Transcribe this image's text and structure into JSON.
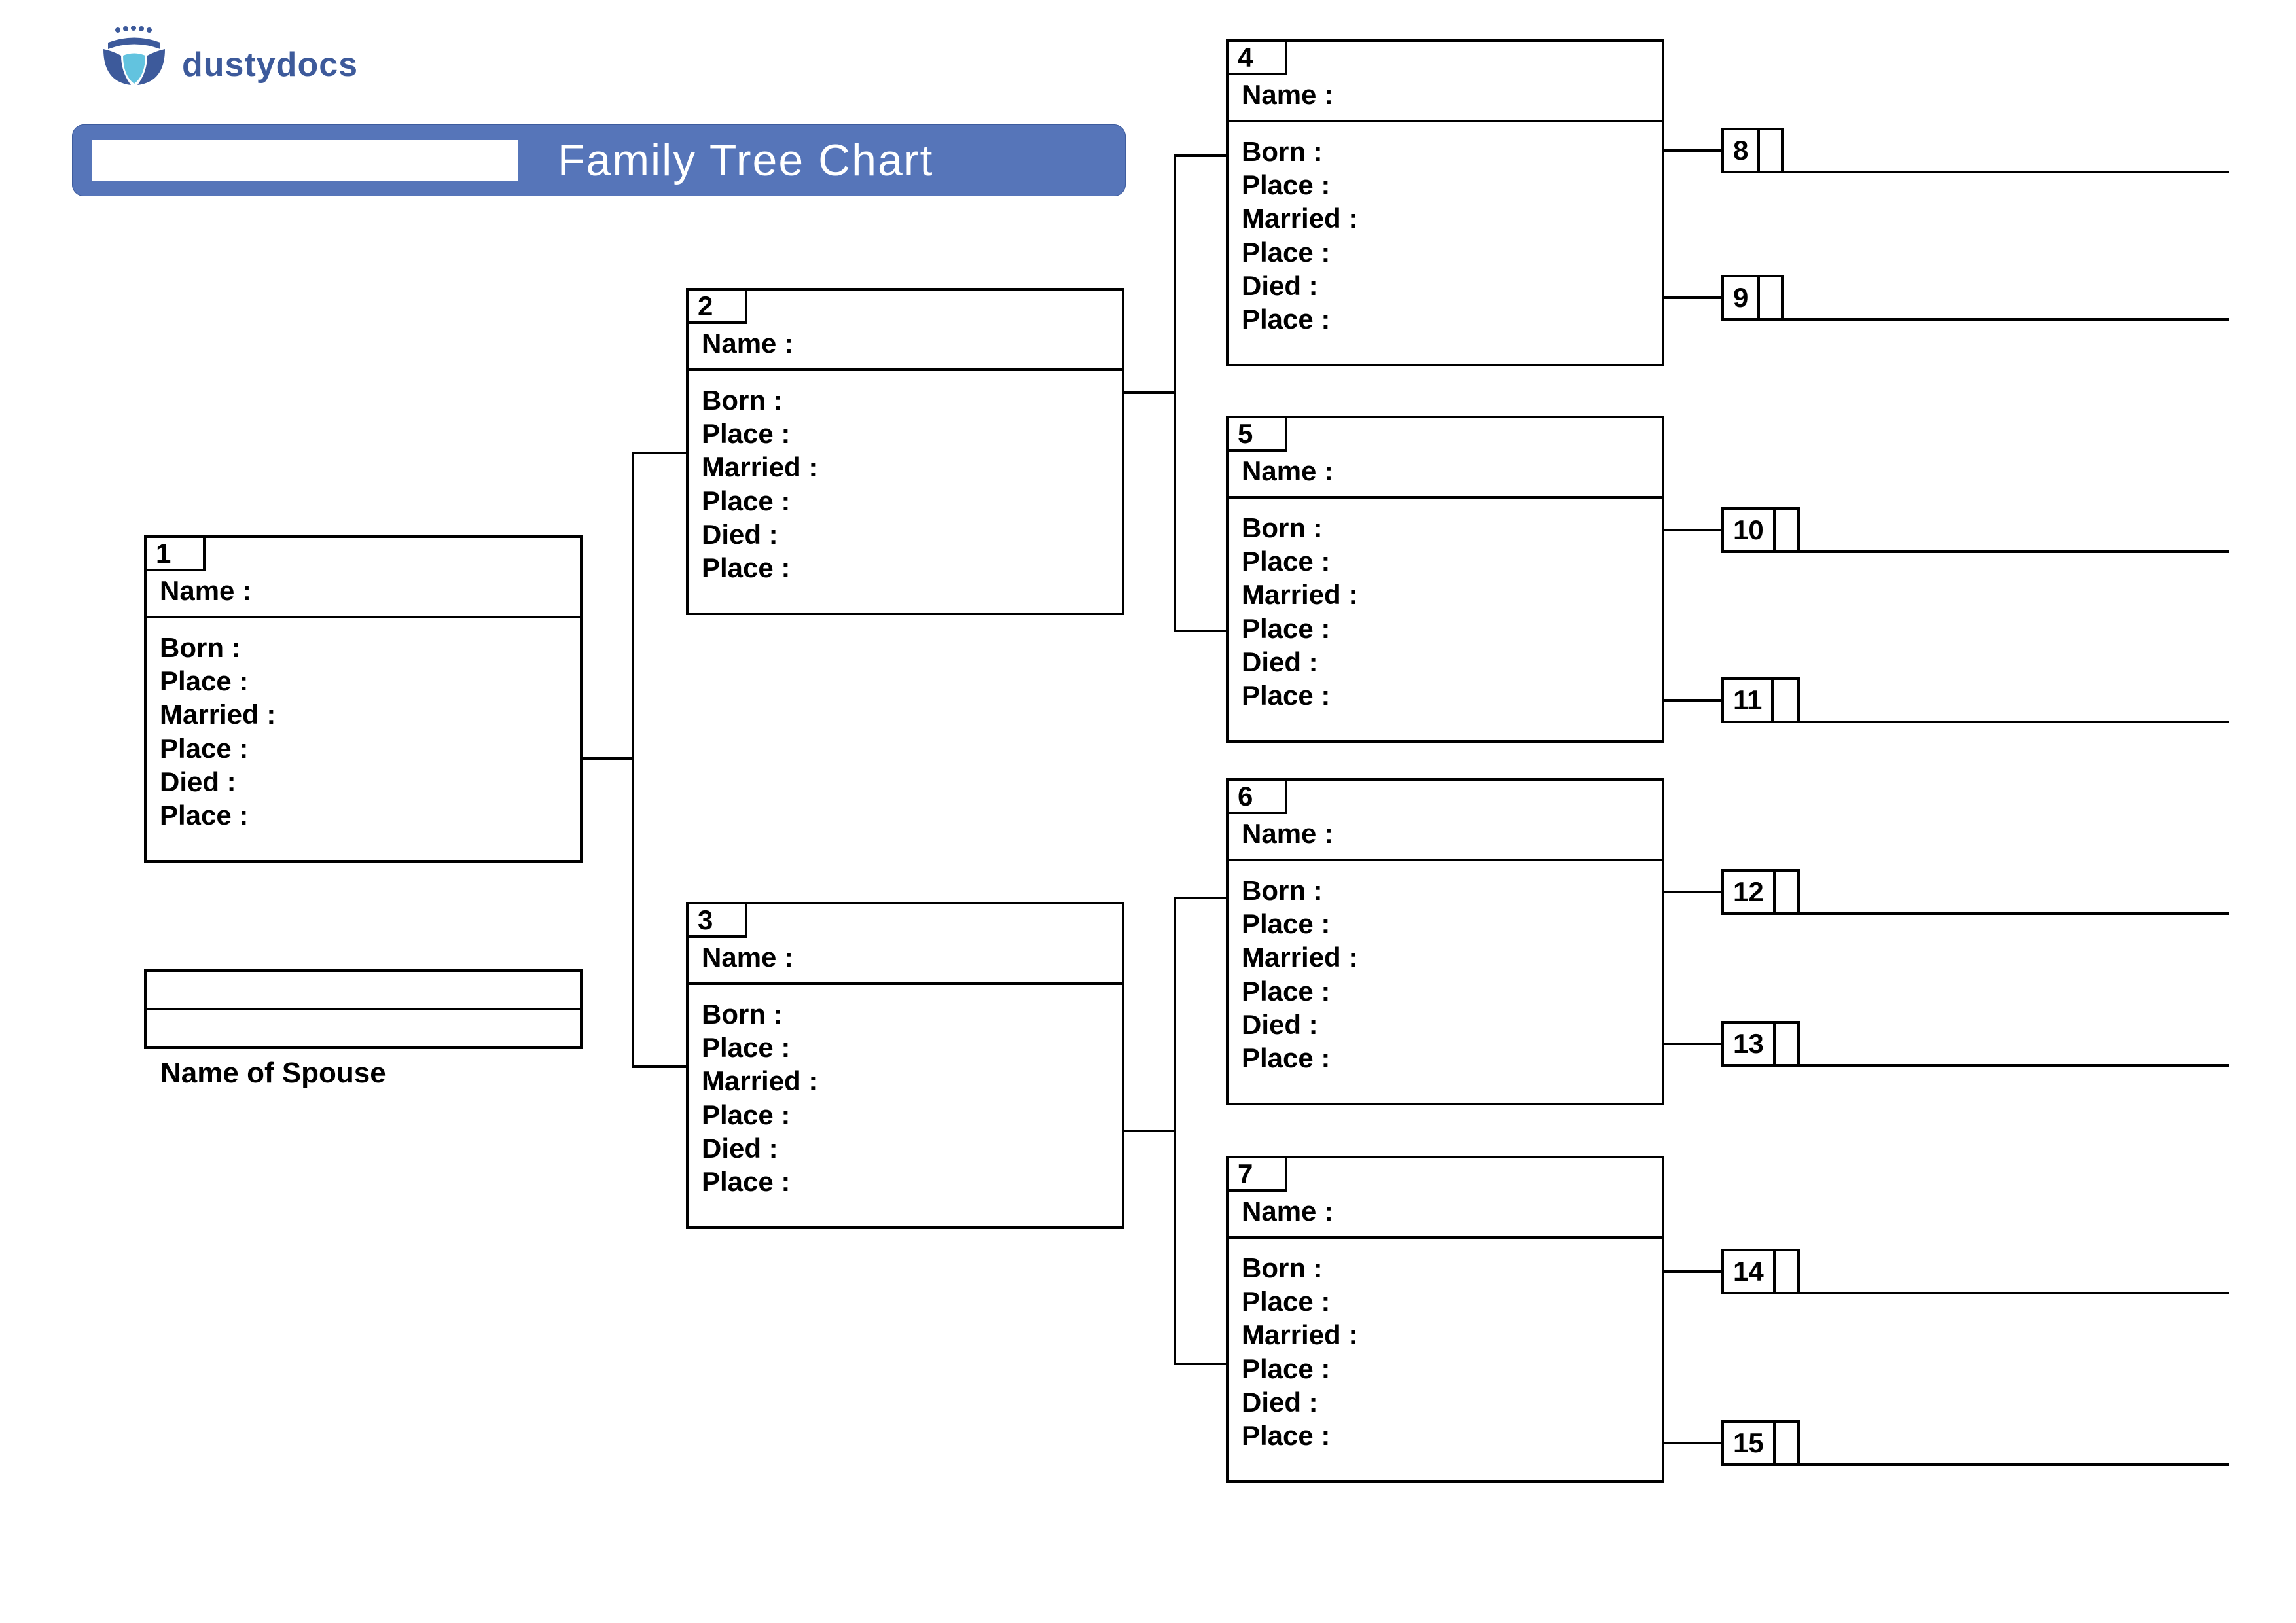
{
  "brand": "dustydocs",
  "header": {
    "title": "Family Tree Chart"
  },
  "labels": {
    "name": "Name :",
    "born": "Born :",
    "place": "Place :",
    "married": "Married :",
    "died": "Died :",
    "spouse": "Name of Spouse"
  },
  "people": {
    "p1": "1",
    "p2": "2",
    "p3": "3",
    "p4": "4",
    "p5": "5",
    "p6": "6",
    "p7": "7",
    "p8": "8",
    "p9": "9",
    "p10": "10",
    "p11": "11",
    "p12": "12",
    "p13": "13",
    "p14": "14",
    "p15": "15"
  }
}
